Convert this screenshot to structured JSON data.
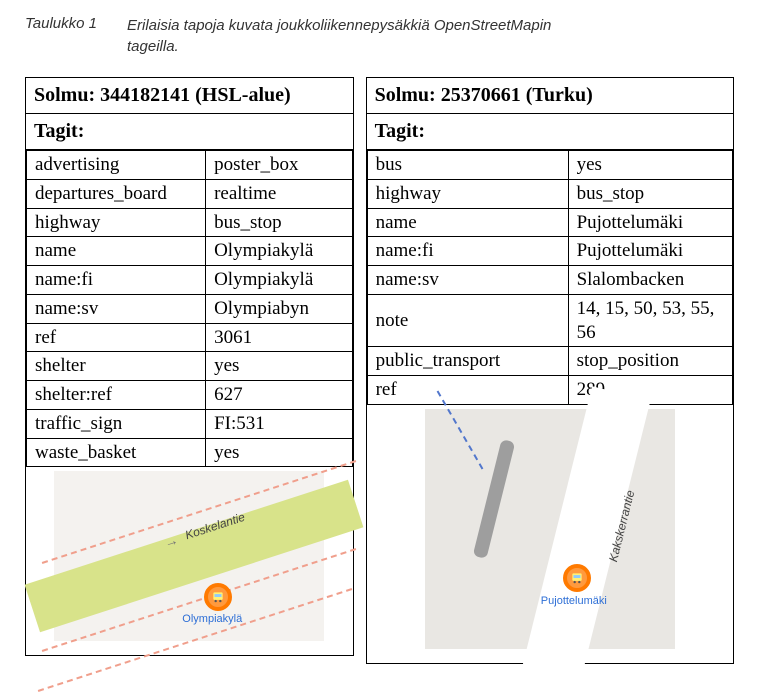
{
  "caption": {
    "label": "Taulukko 1",
    "text": "Erilaisia tapoja kuvata joukkoliikennepysäkkiä OpenStreetMapin tageilla."
  },
  "left": {
    "header": "Solmu: 344182141 (HSL-alue)",
    "tags_label": "Tagit:",
    "rows": [
      {
        "k": "advertising",
        "v": "poster_box"
      },
      {
        "k": "departures_board",
        "v": "realtime"
      },
      {
        "k": "highway",
        "v": "bus_stop"
      },
      {
        "k": "name",
        "v": "Olympiakylä"
      },
      {
        "k": "name:fi",
        "v": "Olympiakylä"
      },
      {
        "k": "name:sv",
        "v": "Olympiabyn"
      },
      {
        "k": "ref",
        "v": "3061"
      },
      {
        "k": "shelter",
        "v": "yes"
      },
      {
        "k": "shelter:ref",
        "v": "627"
      },
      {
        "k": "traffic_sign",
        "v": "FI:531"
      },
      {
        "k": "waste_basket",
        "v": "yes"
      }
    ],
    "map": {
      "road_label": "Koskelantie",
      "stop_label": "Olympiakylä"
    }
  },
  "right": {
    "header": "Solmu: 25370661 (Turku)",
    "tags_label": "Tagit:",
    "rows": [
      {
        "k": "bus",
        "v": "yes"
      },
      {
        "k": "highway",
        "v": "bus_stop"
      },
      {
        "k": "name",
        "v": "Pujottelumäki"
      },
      {
        "k": "name:fi",
        "v": "Pujottelumäki"
      },
      {
        "k": "name:sv",
        "v": "Slalombacken"
      },
      {
        "k": "note",
        "v": "14, 15, 50, 53, 55, 56"
      },
      {
        "k": "public_transport",
        "v": "stop_position"
      },
      {
        "k": "ref",
        "v": "289"
      }
    ],
    "map": {
      "road_label": "Kakskerrantie",
      "stop_label": "Pujottelumäki"
    }
  }
}
